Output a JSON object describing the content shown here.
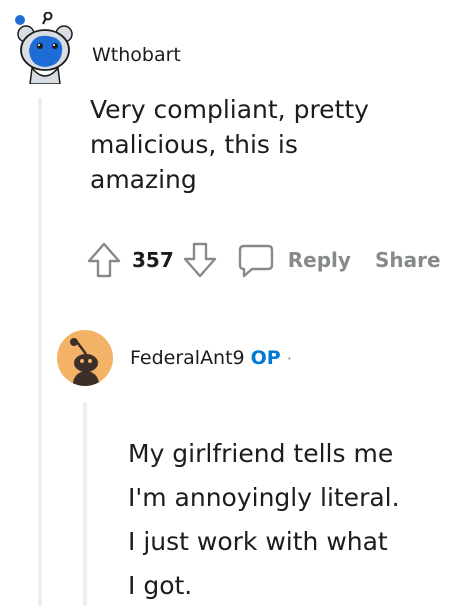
{
  "comment": {
    "username": "Wthobart",
    "body_lines": [
      "Very compliant, pretty",
      "malicious, this is",
      "amazing"
    ],
    "actions": {
      "vote_count": "357",
      "reply_label": "Reply",
      "share_label": "Share"
    }
  },
  "reply": {
    "username": "FederalAnt9",
    "op_badge": "OP",
    "separator": "·",
    "body_lines": [
      "My girlfriend tells me",
      "I'm annoyingly literal.",
      "I just work with what",
      "I got."
    ]
  },
  "colors": {
    "text": "#1c1c1c",
    "meta": "#878a8c",
    "op": "#0079d3",
    "thread_line": "#edeff1",
    "avatar_blue": "#1e6cd6",
    "avatar_orange": "#f4b266"
  },
  "icons": [
    "snoo-avatar-icon",
    "upvote-icon",
    "downvote-icon",
    "comment-bubble-icon",
    "snoo-avatar-orange-icon"
  ]
}
